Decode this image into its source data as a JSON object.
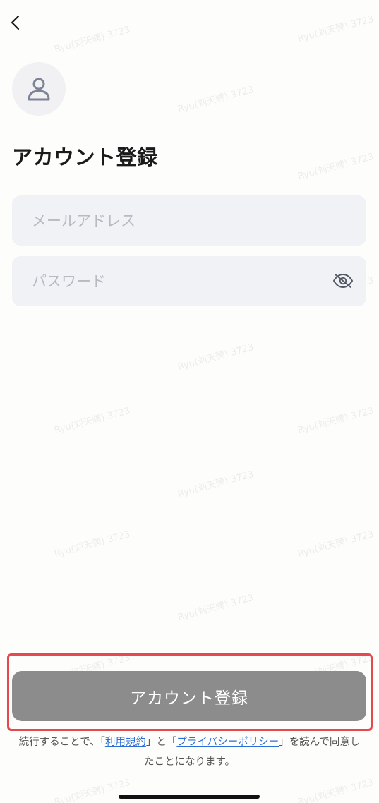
{
  "header": {
    "back_icon": "chevron-left-icon"
  },
  "avatar": {
    "icon": "user-icon"
  },
  "page_title": "アカウント登録",
  "form": {
    "email_placeholder": "メールアドレス",
    "password_placeholder": "パスワード",
    "password_visibility_icon": "eye-off-icon"
  },
  "submit": {
    "label": "アカウント登録"
  },
  "terms": {
    "prefix": "続行することで、「",
    "terms_link": "利用規約",
    "middle": "」と「",
    "privacy_link": "プライバシーポリシー",
    "suffix": "」を読んで同意したことになります。"
  },
  "watermark": {
    "text": "Ryu(刘天骋) 3723"
  },
  "colors": {
    "background": "#fdfdfb",
    "field_background": "#f1f2f6",
    "button_disabled": "#8c8c8c",
    "link": "#2b6fd6",
    "highlight_border": "#e5484d"
  }
}
